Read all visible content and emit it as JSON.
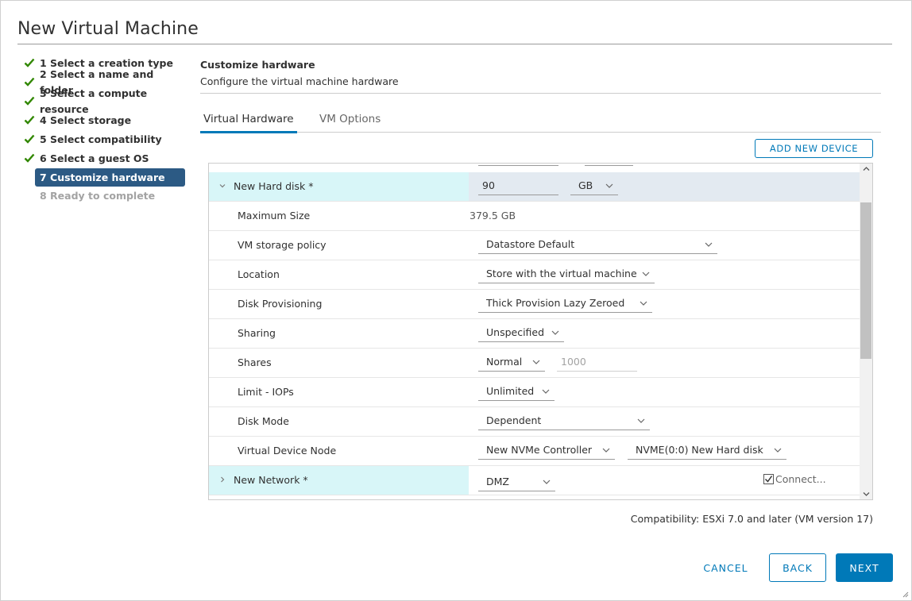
{
  "dialog": {
    "title": "New Virtual Machine"
  },
  "steps": [
    {
      "label": "1 Select a creation type",
      "state": "done"
    },
    {
      "label": "2 Select a name and folder",
      "state": "done"
    },
    {
      "label": "3 Select a compute resource",
      "state": "done"
    },
    {
      "label": "4 Select storage",
      "state": "done"
    },
    {
      "label": "5 Select compatibility",
      "state": "done"
    },
    {
      "label": "6 Select a guest OS",
      "state": "done"
    },
    {
      "label": "7 Customize hardware",
      "state": "active"
    },
    {
      "label": "8 Ready to complete",
      "state": "disabled"
    }
  ],
  "panel": {
    "title": "Customize hardware",
    "subtitle": "Configure the virtual machine hardware"
  },
  "tabs": [
    {
      "label": "Virtual Hardware",
      "active": true
    },
    {
      "label": "VM Options",
      "active": false
    }
  ],
  "toolbar": {
    "add_device": "ADD NEW DEVICE"
  },
  "hard_disk": {
    "label": "New Hard disk *",
    "size": "90",
    "unit": "GB",
    "max_size_label": "Maximum Size",
    "max_size": "379.5 GB",
    "policy_label": "VM storage policy",
    "policy": "Datastore Default",
    "location_label": "Location",
    "location": "Store with the virtual machine",
    "provisioning_label": "Disk Provisioning",
    "provisioning": "Thick Provision Lazy Zeroed",
    "sharing_label": "Sharing",
    "sharing": "Unspecified",
    "shares_label": "Shares",
    "shares": "Normal",
    "shares_value": "1000",
    "iops_label": "Limit - IOPs",
    "iops": "Unlimited",
    "mode_label": "Disk Mode",
    "mode": "Dependent",
    "node_label": "Virtual Device Node",
    "controller": "New NVMe Controller",
    "node": "NVME(0:0) New Hard disk"
  },
  "network": {
    "label": "New Network *",
    "value": "DMZ",
    "connect": "Connect...",
    "connect_checked": true
  },
  "compatibility": "Compatibility: ESXi 7.0 and later (VM version 17)",
  "footer": {
    "cancel": "CANCEL",
    "back": "BACK",
    "next": "NEXT"
  },
  "colors": {
    "accent": "#0079b8",
    "active_step": "#2c5a84",
    "check": "#318700",
    "header_cell": "#d8f6f8"
  }
}
